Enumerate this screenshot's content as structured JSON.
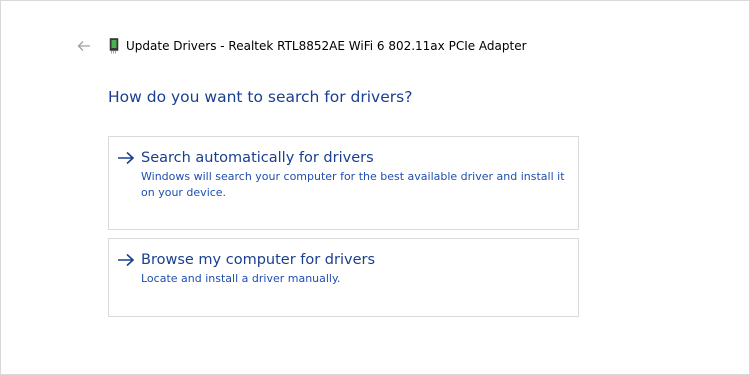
{
  "window": {
    "title": "Update Drivers - Realtek RTL8852AE WiFi 6 802.11ax PCIe Adapter"
  },
  "main": {
    "heading": "How do you want to search for drivers?",
    "options": [
      {
        "title": "Search automatically for drivers",
        "description": "Windows will search your computer for the best available driver and install it on your device."
      },
      {
        "title": "Browse my computer for drivers",
        "description": "Locate and install a driver manually."
      }
    ]
  },
  "icons": {
    "back": "back-arrow-icon",
    "device": "network-adapter-icon",
    "option_arrow": "right-arrow-icon"
  },
  "colors": {
    "heading": "#1a3f8f",
    "link_description": "#1f4fb0",
    "border": "#dadada",
    "back_arrow": "#a0a0a0"
  }
}
